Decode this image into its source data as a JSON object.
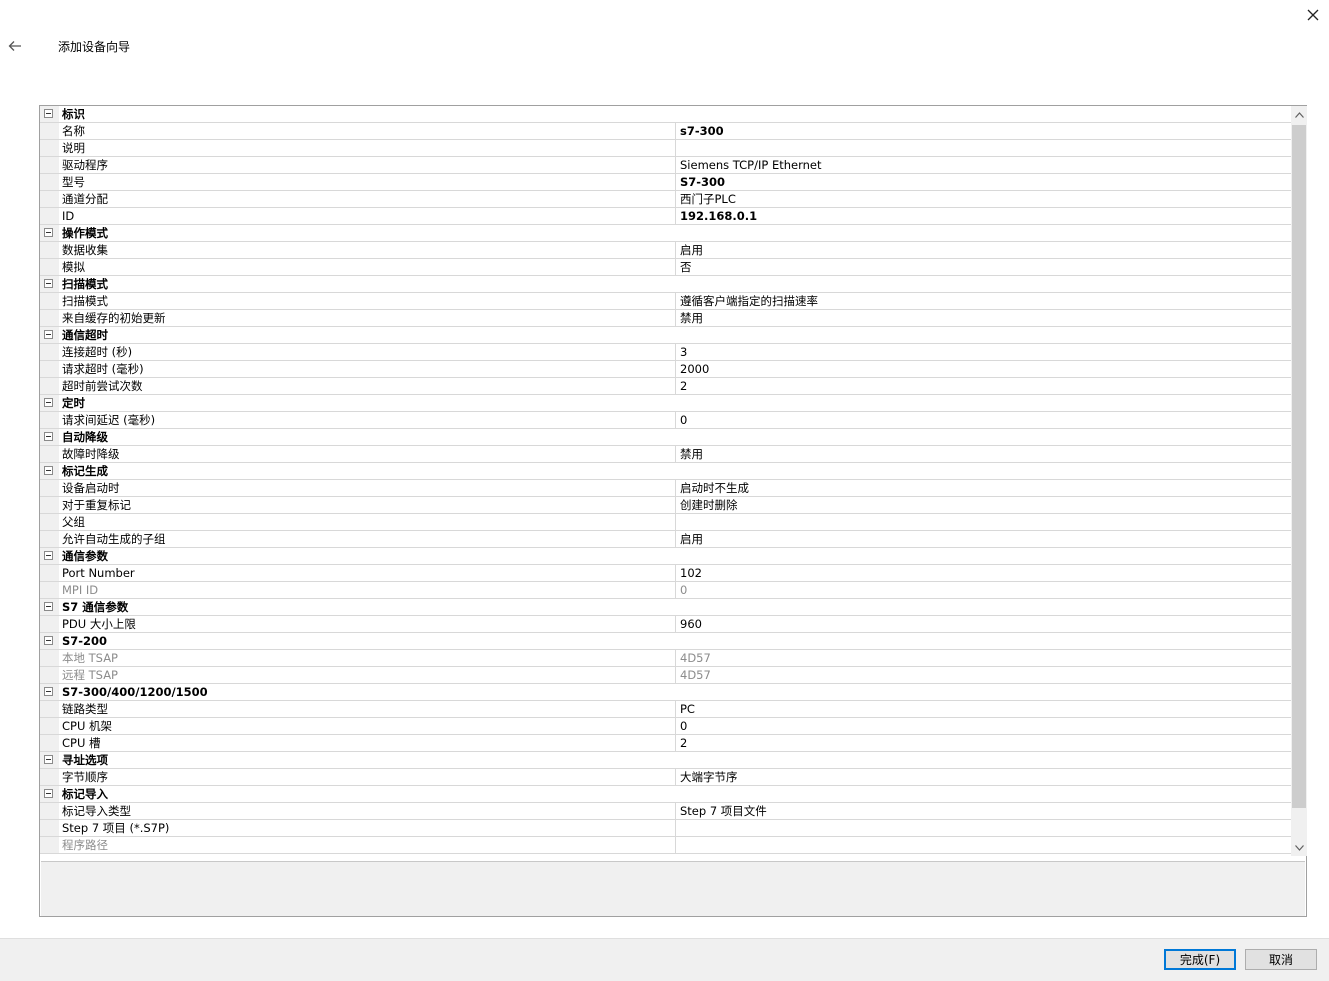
{
  "window": {
    "title": "添加设备向导"
  },
  "property_groups": [
    {
      "label": "标识",
      "props": [
        {
          "name": "名称",
          "value": "s7-300",
          "bold": true
        },
        {
          "name": "说明",
          "value": ""
        },
        {
          "name": "驱动程序",
          "value": "Siemens TCP/IP Ethernet"
        },
        {
          "name": "型号",
          "value": "S7-300",
          "bold": true
        },
        {
          "name": "通道分配",
          "value": "西门子PLC"
        },
        {
          "name": "ID",
          "value": "192.168.0.1",
          "bold": true
        }
      ]
    },
    {
      "label": "操作模式",
      "props": [
        {
          "name": "数据收集",
          "value": "启用"
        },
        {
          "name": "模拟",
          "value": "否"
        }
      ]
    },
    {
      "label": "扫描模式",
      "props": [
        {
          "name": "扫描模式",
          "value": "遵循客户端指定的扫描速率"
        },
        {
          "name": "来自缓存的初始更新",
          "value": "禁用"
        }
      ]
    },
    {
      "label": "通信超时",
      "props": [
        {
          "name": "连接超时 (秒)",
          "value": "3"
        },
        {
          "name": "请求超时 (毫秒)",
          "value": "2000"
        },
        {
          "name": "超时前尝试次数",
          "value": "2"
        }
      ]
    },
    {
      "label": "定时",
      "props": [
        {
          "name": "请求间延迟 (毫秒)",
          "value": "0"
        }
      ]
    },
    {
      "label": "自动降级",
      "props": [
        {
          "name": "故障时降级",
          "value": "禁用"
        }
      ]
    },
    {
      "label": "标记生成",
      "props": [
        {
          "name": "设备启动时",
          "value": "启动时不生成"
        },
        {
          "name": "对于重复标记",
          "value": "创建时删除"
        },
        {
          "name": "父组",
          "value": ""
        },
        {
          "name": "允许自动生成的子组",
          "value": "启用"
        }
      ]
    },
    {
      "label": "通信参数",
      "props": [
        {
          "name": "Port Number",
          "value": "102"
        },
        {
          "name": "MPI ID",
          "value": "0",
          "disabled": true
        }
      ]
    },
    {
      "label": "S7 通信参数",
      "props": [
        {
          "name": "PDU 大小上限",
          "value": "960"
        }
      ]
    },
    {
      "label": "S7-200",
      "props": [
        {
          "name": "本地 TSAP",
          "value": "4D57",
          "disabled": true
        },
        {
          "name": "远程 TSAP",
          "value": "4D57",
          "disabled": true
        }
      ]
    },
    {
      "label": "S7-300/400/1200/1500",
      "props": [
        {
          "name": "链路类型",
          "value": "PC"
        },
        {
          "name": "CPU 机架",
          "value": "0"
        },
        {
          "name": "CPU 槽",
          "value": "2"
        }
      ]
    },
    {
      "label": "寻址选项",
      "props": [
        {
          "name": "字节顺序",
          "value": "大端字节序"
        }
      ]
    },
    {
      "label": "标记导入",
      "props": [
        {
          "name": "标记导入类型",
          "value": "Step 7 项目文件"
        },
        {
          "name": "Step 7 项目 (*.S7P)",
          "value": ""
        },
        {
          "name": "程序路径",
          "value": "",
          "disabled": true
        }
      ]
    }
  ],
  "buttons": {
    "finish": "完成(F)",
    "cancel": "取消"
  },
  "icons": {
    "close": "close-icon",
    "back": "arrow-left-icon",
    "collapse": "minus-box-icon",
    "scroll_up": "chevron-up-icon",
    "scroll_down": "chevron-down-icon"
  },
  "colors": {
    "focus_border": "#0078d7",
    "disabled_text": "#8c8c8c"
  }
}
